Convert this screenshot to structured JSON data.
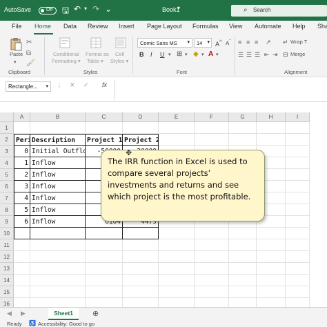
{
  "titlebar": {
    "autosave_label": "AutoSave",
    "autosave_state": "Off",
    "doc_title": "Book1",
    "search_placeholder": "Search"
  },
  "tabs": [
    "File",
    "Home",
    "Data",
    "Review",
    "Insert",
    "Page Layout",
    "Formulas",
    "View",
    "Automate",
    "Help",
    "Sha"
  ],
  "ribbon": {
    "paste_label": "Paste",
    "clipboard_label": "Clipboard",
    "conditional_formatting": [
      "Conditional",
      "Formatting ▾"
    ],
    "format_as_table": [
      "Format as",
      "Table ▾"
    ],
    "cell_styles": [
      "Cell",
      "Styles ▾"
    ],
    "styles_label": "Styles",
    "font_name": "Comic Sans MS",
    "font_size": "14",
    "font_label": "Font",
    "wrap_text": "Wrap T",
    "merge": "Merge",
    "alignment_label": "Alignment"
  },
  "formula_bar": {
    "name_box": "Rectangle...",
    "fx": "fx"
  },
  "columns": [
    "A",
    "B",
    "C",
    "D",
    "E",
    "F",
    "G",
    "H",
    "I"
  ],
  "rows": [
    "1",
    "2",
    "3",
    "4",
    "5",
    "6",
    "7",
    "8",
    "9",
    "10",
    "11",
    "12",
    "13",
    "14",
    "15",
    "16"
  ],
  "table": {
    "headers": [
      "Period",
      "Description",
      "Project 1",
      "Project 2"
    ],
    "rows": [
      [
        "0",
        "Initial Outflow",
        "-50000",
        "-30000"
      ],
      [
        "1",
        "Inflow",
        "",
        ""
      ],
      [
        "2",
        "Inflow",
        "",
        ""
      ],
      [
        "3",
        "Inflow",
        "",
        ""
      ],
      [
        "4",
        "Inflow",
        "",
        ""
      ],
      [
        "5",
        "Inflow",
        "",
        ""
      ],
      [
        "6",
        "Inflow",
        "6104",
        "4479"
      ]
    ]
  },
  "callout": {
    "text": "The IRR function in Excel is used to compare several projects’ investments and returns and see which project is the most profitable."
  },
  "sheet_tabs": [
    "Sheet1"
  ],
  "status": {
    "ready": "Ready",
    "accessibility": "Accessibility: Good to go"
  },
  "colors": {
    "accent": "#217346",
    "callout_fill": "#fff6cc"
  }
}
